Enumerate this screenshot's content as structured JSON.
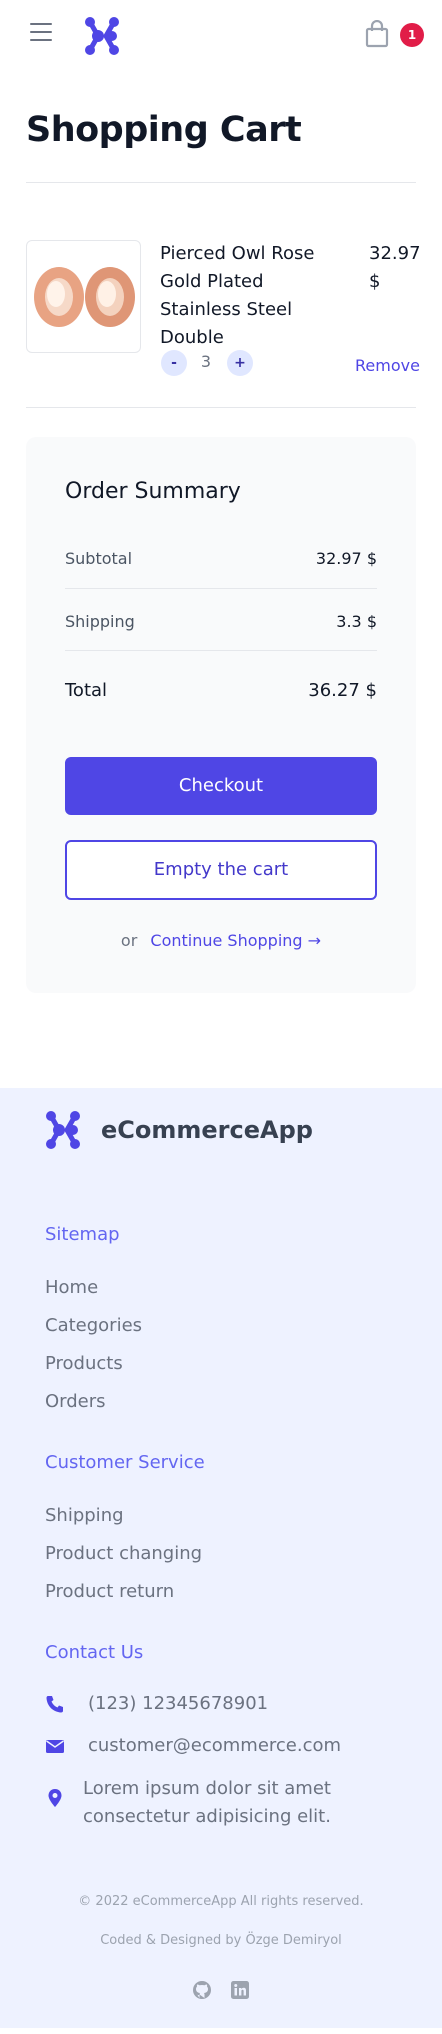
{
  "header": {
    "menu_icon": "hamburger-icon",
    "logo_icon": "brand-logo",
    "cart_icon": "shopping-bag-icon",
    "cart_count": "1",
    "brand_color": "#4f46e5",
    "badge_color": "#e11d48"
  },
  "page": {
    "title": "Shopping Cart"
  },
  "cart": {
    "items": [
      {
        "name": "Pierced Owl Rose Gold Plated Stainless Steel Double",
        "price": "32.97 $",
        "quantity": "3",
        "minus_label": "-",
        "plus_label": "+",
        "remove_label": "Remove"
      }
    ]
  },
  "summary": {
    "title": "Order Summary",
    "subtotal_label": "Subtotal",
    "subtotal_value": "32.97 $",
    "shipping_label": "Shipping",
    "shipping_value": "3.3 $",
    "total_label": "Total",
    "total_value": "36.27 $",
    "checkout_label": "Checkout",
    "empty_label": "Empty the cart",
    "or_text": "or",
    "continue_label": "Continue Shopping →"
  },
  "footer": {
    "brand": "eCommerceApp",
    "sitemap_heading": "Sitemap",
    "sitemap_links": [
      "Home",
      "Categories",
      "Products",
      "Orders"
    ],
    "service_heading": "Customer Service",
    "service_links": [
      "Shipping",
      "Product changing",
      "Product return"
    ],
    "contact_heading": "Contact Us",
    "phone": "(123) 12345678901",
    "email": "customer@ecommerce.com",
    "address": "Lorem ipsum dolor sit amet consectetur adipisicing elit.",
    "copyright": "© 2022 eCommerceApp All rights reserved.",
    "credits": "Coded & Designed by Özge Demiryol",
    "social_icons": [
      "github-icon",
      "linkedin-icon"
    ]
  }
}
